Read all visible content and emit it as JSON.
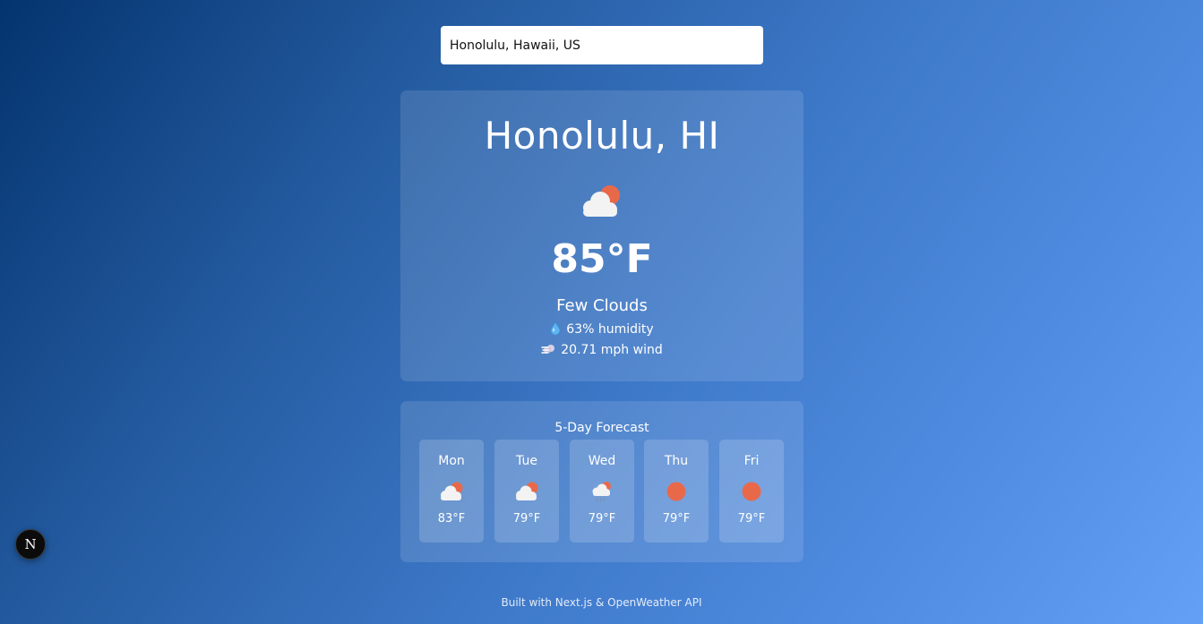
{
  "search": {
    "value": "Honolulu, Hawaii, US",
    "icon": "none"
  },
  "current": {
    "city": "Honolulu, HI",
    "icon": "few-clouds-icon",
    "temperature": "85°F",
    "condition": "Few Clouds",
    "humidity": "63% humidity",
    "humidity_icon": "droplet-icon",
    "wind": "20.71 mph wind",
    "wind_icon": "wind-icon"
  },
  "forecast": {
    "title": "5-Day Forecast",
    "days": [
      {
        "day": "Mon",
        "icon": "few-clouds-icon",
        "temp": "83°F"
      },
      {
        "day": "Tue",
        "icon": "few-clouds-icon",
        "temp": "79°F"
      },
      {
        "day": "Wed",
        "icon": "rain-icon",
        "temp": "79°F"
      },
      {
        "day": "Thu",
        "icon": "sun-icon",
        "temp": "79°F"
      },
      {
        "day": "Fri",
        "icon": "sun-icon",
        "temp": "79°F"
      }
    ]
  },
  "footer": {
    "text": "Built with Next.js & OpenWeather API"
  },
  "dev_badge": {
    "label": "N"
  },
  "colors": {
    "sun": "#e8694a",
    "cloud": "#f3f3f3",
    "background_start": "#04346f",
    "background_end": "#63a0f6"
  }
}
